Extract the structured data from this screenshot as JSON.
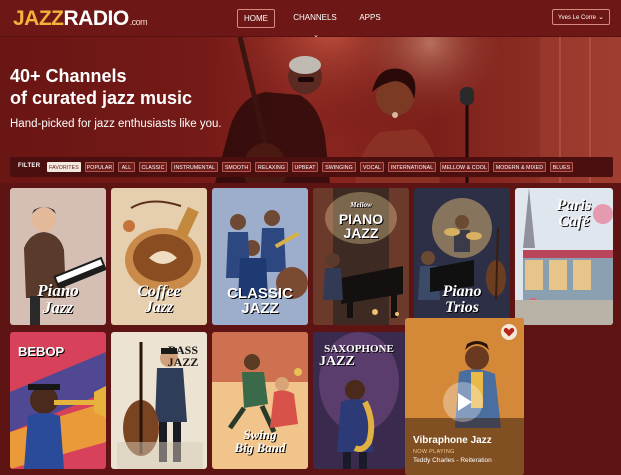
{
  "brand": {
    "logo_jazz": "JAZZ",
    "logo_radio": "RADIO",
    "logo_com": ".com"
  },
  "nav": {
    "home": "HOME",
    "channels": "CHANNELS",
    "apps": "APPS",
    "user": "Yves Le Corre"
  },
  "hero": {
    "title_line1": "40+ Channels",
    "title_line2": "of curated jazz music",
    "subtitle": "Hand-picked for jazz enthusiasts like you."
  },
  "filter": {
    "label": "FILTER",
    "chips": [
      "FAVORITES",
      "POPULAR",
      "ALL",
      "CLASSIC",
      "INSTRUMENTAL",
      "SMOOTH",
      "RELAXING",
      "UPBEAT",
      "SWINGING",
      "VOCAL",
      "INTERNATIONAL",
      "MELLOW & COOL",
      "MODERN & MIXED",
      "BLUES"
    ],
    "active": "FAVORITES"
  },
  "channels": {
    "piano_jazz": {
      "line1": "Piano",
      "line2": "Jazz"
    },
    "coffee_jazz": {
      "line1": "Coffee",
      "line2": "Jazz"
    },
    "classic_jazz": {
      "line1": "CLASSIC",
      "line2": "JAZZ"
    },
    "mellow_piano": {
      "small": "Mellow",
      "line1": "PIANO",
      "line2": "JAZZ"
    },
    "piano_trios": {
      "line1": "Piano",
      "line2": "Trios"
    },
    "paris_cafe": {
      "line1": "Paris",
      "line2": "Café"
    },
    "bebop": {
      "line1": "BEBOP"
    },
    "bass_jazz": {
      "line1": "BASS",
      "line2": "JAZZ"
    },
    "swing_big_band": {
      "line1": "Swing",
      "line2": "Big Band"
    },
    "saxophone_jazz": {
      "line1": "SAXOPHONE",
      "line2": "JAZZ"
    }
  },
  "now_playing": {
    "channel": "Vibraphone Jazz",
    "label": "NOW PLAYING",
    "track": "Teddy Charles - Reiteration"
  },
  "colors": {
    "accent": "#f2b23c",
    "background": "#5e1412",
    "nav": "#6d1816"
  }
}
